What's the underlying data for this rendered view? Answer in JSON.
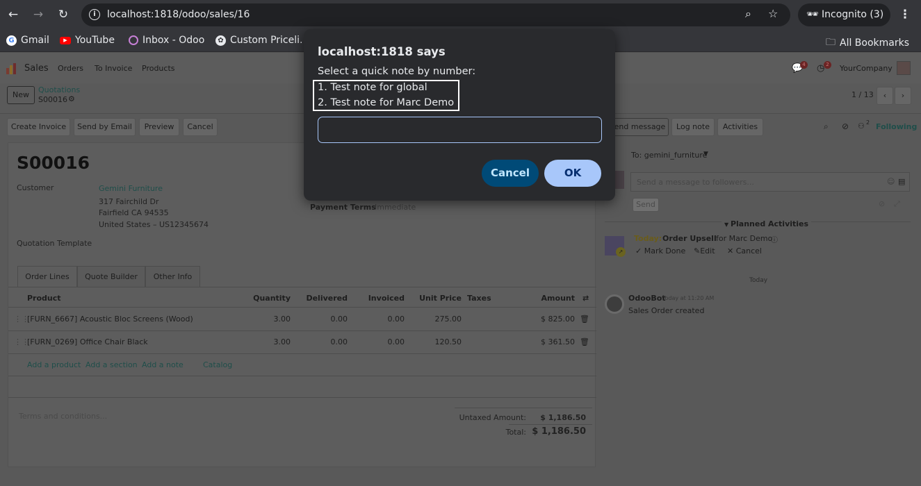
{
  "browser": {
    "url": "localhost:1818/odoo/sales/16",
    "incognito_label": "Incognito (3)",
    "bookmarks": [
      "Gmail",
      "YouTube",
      "Inbox - Odoo",
      "Custom Priceli..."
    ],
    "all_bookmarks_label": "All Bookmarks"
  },
  "topnav": {
    "app_name": "Sales",
    "menu": [
      "Orders",
      "To Invoice",
      "Products"
    ],
    "messages_count": "4",
    "activities_count": "2",
    "company": "YourCompany"
  },
  "control_panel": {
    "new_label": "New",
    "breadcrumb_parent": "Quotations",
    "record_name": "S00016",
    "pager": "1 / 13",
    "actions": [
      "Create Invoice",
      "Send by Email",
      "Preview",
      "Cancel"
    ]
  },
  "form": {
    "title": "S00016",
    "customer_label": "Customer",
    "customer_name": "Gemini Furniture",
    "address_line1": "317 Fairchild Dr",
    "address_line2": "Fairfield CA 94535",
    "address_line3": "United States – US12345674",
    "payment_terms_label": "Payment Terms",
    "payment_terms_value": "Immediate",
    "quotation_template_label": "Quotation Template",
    "tabs": [
      "Order Lines",
      "Quote Builder",
      "Other Info"
    ],
    "columns": {
      "product": "Product",
      "quantity": "Quantity",
      "delivered": "Delivered",
      "invoiced": "Invoiced",
      "unit_price": "Unit Price",
      "taxes": "Taxes",
      "amount": "Amount"
    },
    "lines": [
      {
        "product": "[FURN_6667] Acoustic Bloc Screens (Wood)",
        "quantity": "3.00",
        "delivered": "0.00",
        "invoiced": "0.00",
        "unit_price": "275.00",
        "amount": "$ 825.00"
      },
      {
        "product": "[FURN_0269] Office Chair Black",
        "quantity": "3.00",
        "delivered": "0.00",
        "invoiced": "0.00",
        "unit_price": "120.50",
        "amount": "$ 361.50"
      }
    ],
    "add_links": [
      "Add a product",
      "Add a section",
      "Add a note",
      "Catalog"
    ],
    "terms_placeholder": "Terms and conditions...",
    "untaxed_label": "Untaxed Amount:",
    "untaxed_value": "$ 1,186.50",
    "total_label": "Total:",
    "total_value": "$ 1,186.50"
  },
  "chatter": {
    "send_message": "Send message",
    "log_note": "Log note",
    "activities": "Activities",
    "followers_count": "2",
    "following": "Following",
    "to_label": "To: gemini_furniture",
    "message_placeholder": "Send a message to followers...",
    "send_label": "Send",
    "planned_activities": "Planned Activities",
    "activity_today": "Today:",
    "activity_title": "Order Upsell",
    "activity_for": "for Marc Demo",
    "mark_done": "Mark Done",
    "edit": "Edit",
    "cancel": "Cancel",
    "date_separator": "Today",
    "bot_name": "OdooBot",
    "bot_time": "Today at 11:20 AM",
    "bot_message": "Sales Order created"
  },
  "dialog": {
    "title": "localhost:1818 says",
    "message": "Select a quick note by number:",
    "options": [
      "1. Test note for global",
      "2. Test note for Marc Demo"
    ],
    "input_value": "",
    "cancel_label": "Cancel",
    "ok_label": "OK"
  }
}
